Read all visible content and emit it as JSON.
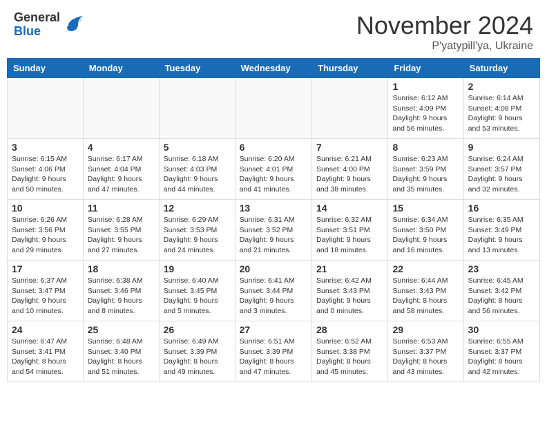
{
  "header": {
    "logo_general": "General",
    "logo_blue": "Blue",
    "month_title": "November 2024",
    "location": "P'yatypill'ya, Ukraine"
  },
  "days_of_week": [
    "Sunday",
    "Monday",
    "Tuesday",
    "Wednesday",
    "Thursday",
    "Friday",
    "Saturday"
  ],
  "weeks": [
    [
      {
        "date": "",
        "info": ""
      },
      {
        "date": "",
        "info": ""
      },
      {
        "date": "",
        "info": ""
      },
      {
        "date": "",
        "info": ""
      },
      {
        "date": "",
        "info": ""
      },
      {
        "date": "1",
        "info": "Sunrise: 6:12 AM\nSunset: 4:09 PM\nDaylight: 9 hours and 56 minutes."
      },
      {
        "date": "2",
        "info": "Sunrise: 6:14 AM\nSunset: 4:08 PM\nDaylight: 9 hours and 53 minutes."
      }
    ],
    [
      {
        "date": "3",
        "info": "Sunrise: 6:15 AM\nSunset: 4:06 PM\nDaylight: 9 hours and 50 minutes."
      },
      {
        "date": "4",
        "info": "Sunrise: 6:17 AM\nSunset: 4:04 PM\nDaylight: 9 hours and 47 minutes."
      },
      {
        "date": "5",
        "info": "Sunrise: 6:18 AM\nSunset: 4:03 PM\nDaylight: 9 hours and 44 minutes."
      },
      {
        "date": "6",
        "info": "Sunrise: 6:20 AM\nSunset: 4:01 PM\nDaylight: 9 hours and 41 minutes."
      },
      {
        "date": "7",
        "info": "Sunrise: 6:21 AM\nSunset: 4:00 PM\nDaylight: 9 hours and 38 minutes."
      },
      {
        "date": "8",
        "info": "Sunrise: 6:23 AM\nSunset: 3:59 PM\nDaylight: 9 hours and 35 minutes."
      },
      {
        "date": "9",
        "info": "Sunrise: 6:24 AM\nSunset: 3:57 PM\nDaylight: 9 hours and 32 minutes."
      }
    ],
    [
      {
        "date": "10",
        "info": "Sunrise: 6:26 AM\nSunset: 3:56 PM\nDaylight: 9 hours and 29 minutes."
      },
      {
        "date": "11",
        "info": "Sunrise: 6:28 AM\nSunset: 3:55 PM\nDaylight: 9 hours and 27 minutes."
      },
      {
        "date": "12",
        "info": "Sunrise: 6:29 AM\nSunset: 3:53 PM\nDaylight: 9 hours and 24 minutes."
      },
      {
        "date": "13",
        "info": "Sunrise: 6:31 AM\nSunset: 3:52 PM\nDaylight: 9 hours and 21 minutes."
      },
      {
        "date": "14",
        "info": "Sunrise: 6:32 AM\nSunset: 3:51 PM\nDaylight: 9 hours and 18 minutes."
      },
      {
        "date": "15",
        "info": "Sunrise: 6:34 AM\nSunset: 3:50 PM\nDaylight: 9 hours and 16 minutes."
      },
      {
        "date": "16",
        "info": "Sunrise: 6:35 AM\nSunset: 3:49 PM\nDaylight: 9 hours and 13 minutes."
      }
    ],
    [
      {
        "date": "17",
        "info": "Sunrise: 6:37 AM\nSunset: 3:47 PM\nDaylight: 9 hours and 10 minutes."
      },
      {
        "date": "18",
        "info": "Sunrise: 6:38 AM\nSunset: 3:46 PM\nDaylight: 9 hours and 8 minutes."
      },
      {
        "date": "19",
        "info": "Sunrise: 6:40 AM\nSunset: 3:45 PM\nDaylight: 9 hours and 5 minutes."
      },
      {
        "date": "20",
        "info": "Sunrise: 6:41 AM\nSunset: 3:44 PM\nDaylight: 9 hours and 3 minutes."
      },
      {
        "date": "21",
        "info": "Sunrise: 6:42 AM\nSunset: 3:43 PM\nDaylight: 9 hours and 0 minutes."
      },
      {
        "date": "22",
        "info": "Sunrise: 6:44 AM\nSunset: 3:43 PM\nDaylight: 8 hours and 58 minutes."
      },
      {
        "date": "23",
        "info": "Sunrise: 6:45 AM\nSunset: 3:42 PM\nDaylight: 8 hours and 56 minutes."
      }
    ],
    [
      {
        "date": "24",
        "info": "Sunrise: 6:47 AM\nSunset: 3:41 PM\nDaylight: 8 hours and 54 minutes."
      },
      {
        "date": "25",
        "info": "Sunrise: 6:48 AM\nSunset: 3:40 PM\nDaylight: 8 hours and 51 minutes."
      },
      {
        "date": "26",
        "info": "Sunrise: 6:49 AM\nSunset: 3:39 PM\nDaylight: 8 hours and 49 minutes."
      },
      {
        "date": "27",
        "info": "Sunrise: 6:51 AM\nSunset: 3:39 PM\nDaylight: 8 hours and 47 minutes."
      },
      {
        "date": "28",
        "info": "Sunrise: 6:52 AM\nSunset: 3:38 PM\nDaylight: 8 hours and 45 minutes."
      },
      {
        "date": "29",
        "info": "Sunrise: 6:53 AM\nSunset: 3:37 PM\nDaylight: 8 hours and 43 minutes."
      },
      {
        "date": "30",
        "info": "Sunrise: 6:55 AM\nSunset: 3:37 PM\nDaylight: 8 hours and 42 minutes."
      }
    ]
  ]
}
